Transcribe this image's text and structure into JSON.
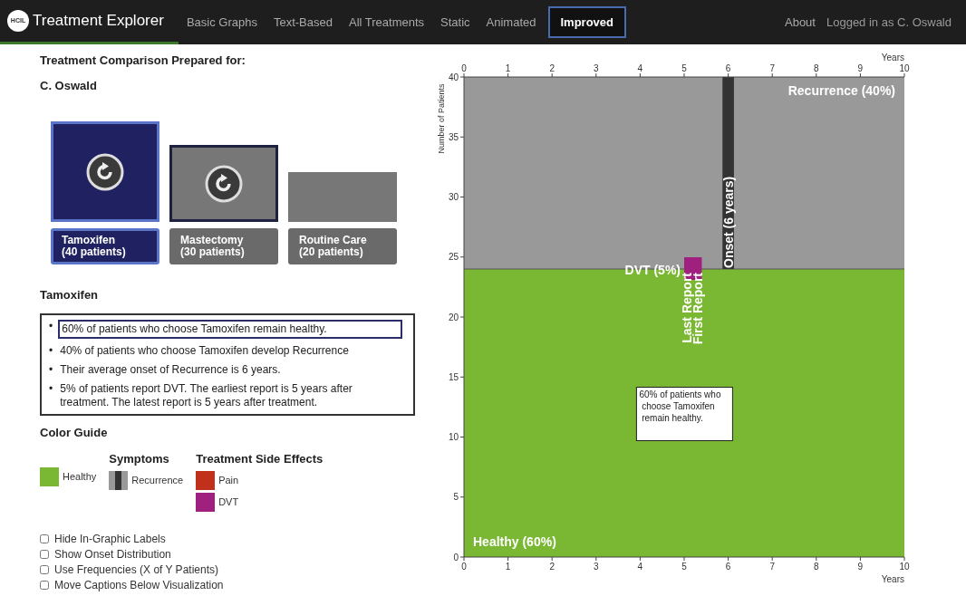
{
  "navbar": {
    "logo_text": "HCIL",
    "brand": "Treatment Explorer",
    "items": [
      {
        "label": "Basic Graphs",
        "selected": false
      },
      {
        "label": "Text-Based",
        "selected": false
      },
      {
        "label": "All Treatments",
        "selected": false
      },
      {
        "label": "Static",
        "selected": false
      },
      {
        "label": "Animated",
        "selected": false
      },
      {
        "label": "Improved",
        "selected": true
      }
    ],
    "right_links": [
      "About",
      "Logged in as C. Oswald"
    ]
  },
  "header": {
    "title": "Treatment Comparison Prepared for:",
    "patient": "C. Oswald"
  },
  "treatments": [
    {
      "name": "Tamoxifen",
      "patients": "(40 patients)",
      "selected": true,
      "focused": false,
      "replay": true
    },
    {
      "name": "Mastectomy",
      "patients": "(30 patients)",
      "selected": false,
      "focused": true,
      "replay": true
    },
    {
      "name": "Routine Care",
      "patients": "(20 patients)",
      "selected": false,
      "focused": false,
      "replay": false
    }
  ],
  "summary": {
    "title": "Tamoxifen",
    "items": [
      {
        "bullet": "•",
        "text": "60% of patients who choose Tamoxifen remain healthy.",
        "selected": true
      },
      {
        "bullet": "•",
        "text": "40% of patients who choose Tamoxifen develop Recurrence",
        "selected": false
      },
      {
        "bullet": "•",
        "text": "Their average onset of Recurrence is 6 years.",
        "selected": false
      },
      {
        "bullet": "•",
        "text": "5% of patients report DVT. The earliest report is 5 years after treatment. The latest report is 5 years after treatment.",
        "selected": false
      }
    ]
  },
  "color_guide": {
    "title": "Color Guide",
    "groups": [
      {
        "items": [
          {
            "label": "Healthy",
            "kind": "solid",
            "color": "#7ab733"
          }
        ]
      },
      {
        "heading": "Symptoms",
        "items": [
          {
            "label": "Recurrence",
            "kind": "striped",
            "color": "#999999"
          }
        ]
      },
      {
        "heading": "Treatment Side Effects",
        "items": [
          {
            "label": "Pain",
            "kind": "solid",
            "color": "#c0301a"
          },
          {
            "label": "DVT",
            "kind": "solid",
            "color": "#a0207f"
          }
        ]
      }
    ]
  },
  "options": [
    {
      "label": "Hide In-Graphic Labels",
      "checked": false
    },
    {
      "label": "Show Onset Distribution",
      "checked": false
    },
    {
      "label": "Use Frequencies (X of Y Patients)",
      "checked": false
    },
    {
      "label": "Move Captions Below Visualization",
      "checked": false
    }
  ],
  "chart": {
    "chart_data": {
      "type": "area",
      "stacked": true,
      "xlabel": "Years",
      "ylabel": "Number of Patients",
      "x": [
        0,
        10
      ],
      "series": [
        {
          "name": "Healthy (60%)",
          "color": "#7ab733",
          "values": [
            24,
            24
          ]
        },
        {
          "name": "Recurrence (40%)",
          "color": "#999999",
          "values": [
            16,
            16
          ]
        }
      ],
      "xlim": [
        0,
        10
      ],
      "ylim": [
        0,
        40
      ],
      "xticks": [
        0,
        1,
        2,
        3,
        4,
        5,
        6,
        7,
        8,
        9,
        10
      ],
      "yticks": [
        0,
        5,
        10,
        15,
        20,
        25,
        30,
        35,
        40
      ],
      "bands": [
        {
          "axis": "x",
          "from": 5.87,
          "to": 6.13,
          "label": "Onset (6 years)",
          "color": "#333333"
        },
        {
          "axis": "x",
          "from": 5,
          "to": 5.4,
          "label": "DVT (5%)",
          "color": "#a0207f"
        }
      ],
      "annotations": [
        "Last Report",
        "First Report",
        "60% of patients who choose Tamoxifen remain healthy."
      ]
    },
    "bottom_axis": {
      "ticks": [
        "0",
        "1",
        "2",
        "3",
        "4",
        "5",
        "6",
        "7",
        "8",
        "9",
        "10"
      ],
      "title": "Years"
    }
  }
}
